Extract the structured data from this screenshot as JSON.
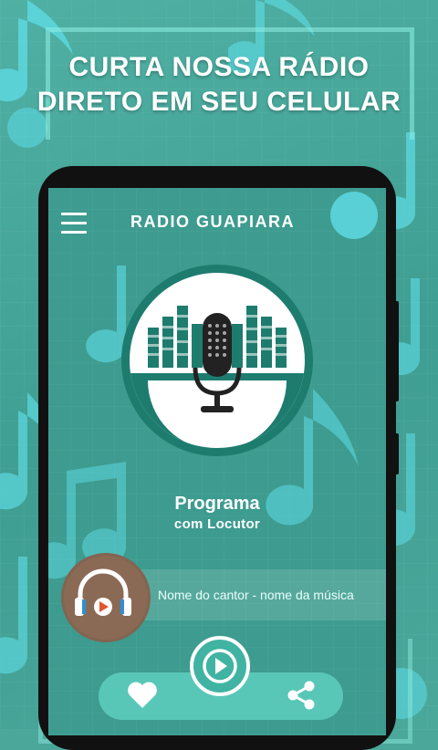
{
  "promo": {
    "headline_line1": "CURTA NOSSA RÁDIO",
    "headline_line2": "DIRETO EM SEU CELULAR"
  },
  "app": {
    "title": "RADIO GUAPIARA",
    "menu_icon": "hamburger-menu-icon"
  },
  "program": {
    "title": "Programa",
    "subtitle": "com Locutor"
  },
  "now_playing": {
    "text": "Nome do cantor - nome da música"
  },
  "controls": {
    "play_icon": "play-icon",
    "favorite_icon": "heart-icon",
    "share_icon": "share-icon"
  },
  "colors": {
    "background": "#4aa79a",
    "screen": "#3d9b8f",
    "accent": "#59c7b7",
    "note": "#5fdde7",
    "logo_dark": "#1e7c6f",
    "avatar": "#8a6a55"
  }
}
